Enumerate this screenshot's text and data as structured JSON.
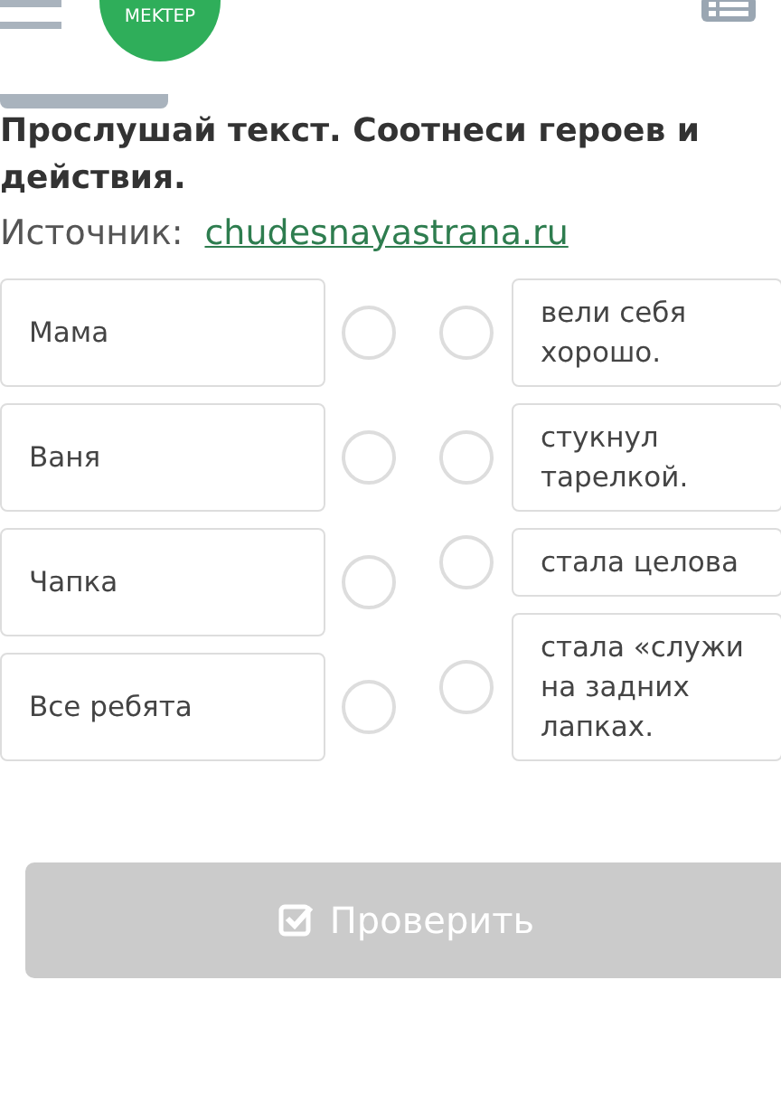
{
  "header": {
    "logo": "MEKTEP"
  },
  "task": {
    "title_lines": [
      "Прослушай текст. Соотнеси героев и",
      "действия."
    ],
    "source_label": "Источник:",
    "source_link": "chudesnayastrana.ru"
  },
  "heroes": [
    {
      "text": "Мама"
    },
    {
      "text": "Ваня"
    },
    {
      "text": "Чапка"
    },
    {
      "text": "Все ребята"
    }
  ],
  "actions": [
    {
      "text": "вели себя хорошо."
    },
    {
      "text": "стукнул тарелкой."
    },
    {
      "text": "стала целова"
    },
    {
      "text": "стала «служи на задних лапках."
    }
  ],
  "check_button": {
    "label": "Проверить",
    "disabled": true
  }
}
